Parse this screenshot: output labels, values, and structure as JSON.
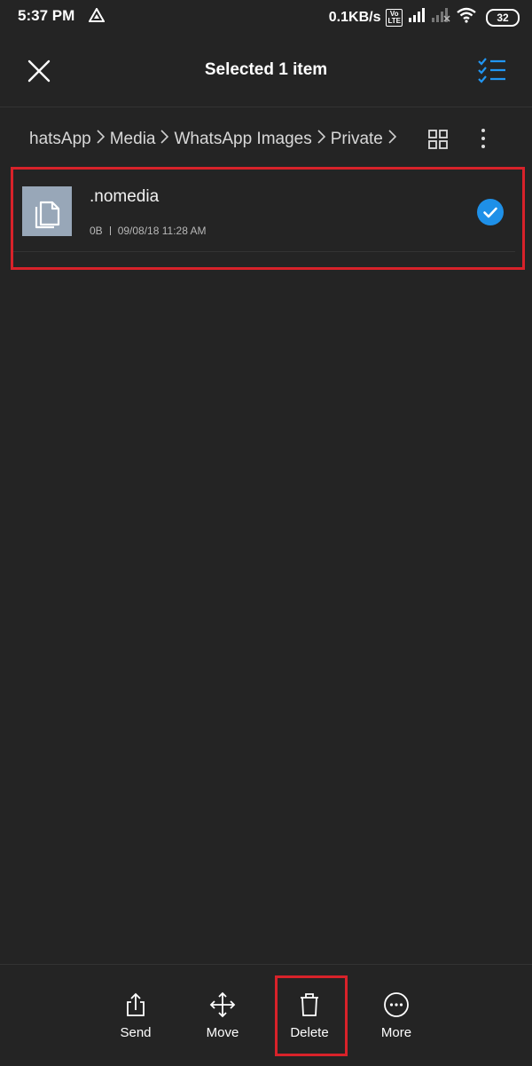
{
  "status_bar": {
    "time": "5:37 PM",
    "network_speed": "0.1KB/s",
    "volte_top": "Vo",
    "volte_bottom": "LTE",
    "battery": "32",
    "icons": [
      "drive-icon",
      "volte-icon",
      "signal-icon",
      "signal-weak-icon",
      "wifi-icon",
      "battery-icon"
    ]
  },
  "header": {
    "title": "Selected 1 item",
    "close_icon": "close-icon",
    "select_all_icon": "select-all-icon",
    "accent": "#2196f3"
  },
  "breadcrumb": {
    "items": [
      "hatsApp",
      "Media",
      "WhatsApp Images",
      "Private"
    ],
    "separator": ">",
    "grid_icon": "grid-view-icon",
    "menu_icon": "more-vert-icon"
  },
  "file": {
    "name": ".nomedia",
    "size": "0B",
    "date": "09/08/18 11:28 AM",
    "selected": true,
    "icon": "file-copy-icon"
  },
  "actions": [
    {
      "label": "Send",
      "icon": "share-icon"
    },
    {
      "label": "Move",
      "icon": "move-icon"
    },
    {
      "label": "Delete",
      "icon": "trash-icon"
    },
    {
      "label": "More",
      "icon": "more-horiz-icon"
    }
  ],
  "colors": {
    "background": "#242424",
    "highlight": "#d8222a",
    "check": "#1e90e8"
  }
}
